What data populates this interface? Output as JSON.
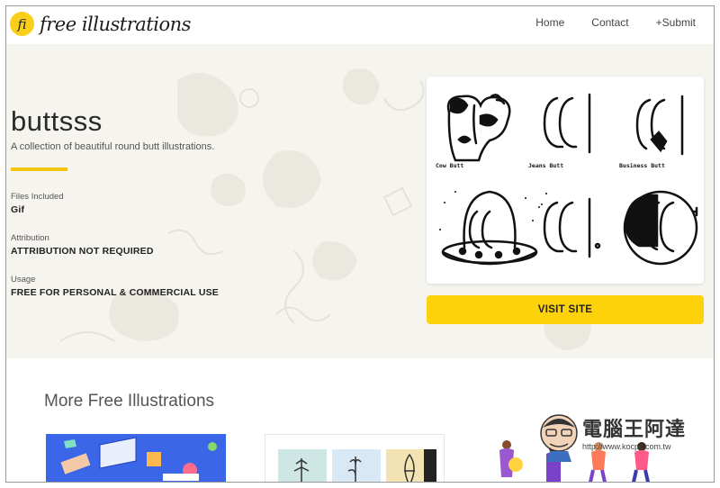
{
  "site": {
    "logo_mark": "fi",
    "logo_text": "free illustrations"
  },
  "nav": {
    "home": "Home",
    "contact": "Contact",
    "submit": "+Submit"
  },
  "hero": {
    "title": "buttsss",
    "subtitle": "A collection of beautiful round butt illustrations.",
    "files_label": "Files Included",
    "files_value": "Gif",
    "attribution_label": "Attribution",
    "attribution_value": "ATTRIBUTION NOT REQUIRED",
    "usage_label": "Usage",
    "usage_value": "FREE FOR PERSONAL & COMMERCIAL USE",
    "visit_button": "VISIT SITE"
  },
  "preview": {
    "captions": [
      "Cow Butt",
      "Jeans Butt",
      "Business Butt"
    ]
  },
  "more": {
    "title": "More Free Illustrations"
  },
  "watermark": {
    "name": "電腦王阿達",
    "url": "http://www.kocpc.com.tw"
  },
  "colors": {
    "accent": "#fed20b",
    "hero_bg": "#f6f4ef",
    "thumb_blue": "#3b66e8"
  }
}
